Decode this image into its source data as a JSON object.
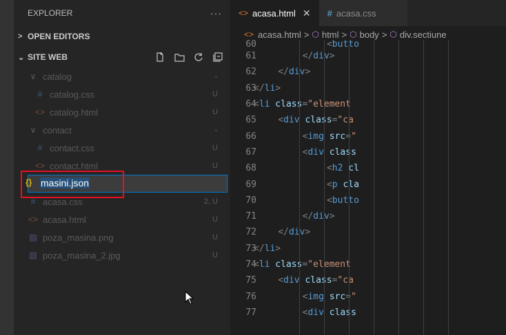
{
  "sidebar": {
    "title": "EXPLORER",
    "more": "···",
    "open_editors": "OPEN EDITORS",
    "workspace": "SITE WEB",
    "tree": [
      {
        "name": "catalog",
        "icon": "chevron-down-icon",
        "badge": "",
        "kind": "folder"
      },
      {
        "name": "catalog.css",
        "icon": "css-file-icon",
        "badge": "U",
        "kind": "css"
      },
      {
        "name": "catalog.html",
        "icon": "html-file-icon",
        "badge": "U",
        "kind": "html"
      },
      {
        "name": "contact",
        "icon": "chevron-down-icon",
        "badge": "",
        "kind": "folder"
      },
      {
        "name": "contact.css",
        "icon": "css-file-icon",
        "badge": "U",
        "kind": "css"
      },
      {
        "name": "contact.html",
        "icon": "html-file-icon",
        "badge": "U",
        "kind": "html"
      }
    ],
    "rename_value": "masini.json",
    "tree_after": [
      {
        "name": "acasa.css",
        "icon": "css-file-icon",
        "badge": "2, U",
        "kind": "css"
      },
      {
        "name": "acasa.html",
        "icon": "html-file-icon",
        "badge": "U",
        "kind": "html"
      },
      {
        "name": "poza_masina.png",
        "icon": "image-file-icon",
        "badge": "U",
        "kind": "img"
      },
      {
        "name": "poza_masina_2.jpg",
        "icon": "image-file-icon",
        "badge": "U",
        "kind": "img"
      }
    ]
  },
  "tabs": [
    {
      "label": "acasa.html",
      "active": true
    },
    {
      "label": "acasa.css",
      "active": false
    }
  ],
  "breadcrumb": [
    "acasa.html",
    "html",
    "body",
    "div.sectiune"
  ],
  "code": {
    "lines": [
      {
        "n": "60",
        "indent": 8,
        "parts": [
          [
            "punct",
            "<"
          ],
          [
            "tag",
            "butto"
          ]
        ]
      },
      {
        "n": "61",
        "indent": 7,
        "parts": [
          [
            "punct",
            "</"
          ],
          [
            "tag",
            "div"
          ],
          [
            "punct",
            ">"
          ]
        ]
      },
      {
        "n": "62",
        "indent": 6,
        "parts": [
          [
            "punct",
            "</"
          ],
          [
            "tag",
            "div"
          ],
          [
            "punct",
            ">"
          ]
        ]
      },
      {
        "n": "63",
        "indent": 5,
        "parts": [
          [
            "punct",
            "</"
          ],
          [
            "tag",
            "li"
          ],
          [
            "punct",
            ">"
          ]
        ]
      },
      {
        "n": "64",
        "indent": 5,
        "parts": [
          [
            "punct",
            "<"
          ],
          [
            "tag",
            "li"
          ],
          [
            "attr",
            " class"
          ],
          [
            "punct",
            "="
          ],
          [
            "str",
            "\"element"
          ]
        ]
      },
      {
        "n": "65",
        "indent": 6,
        "parts": [
          [
            "punct",
            "<"
          ],
          [
            "tag",
            "div"
          ],
          [
            "attr",
            " class"
          ],
          [
            "punct",
            "="
          ],
          [
            "str",
            "\"ca"
          ]
        ]
      },
      {
        "n": "66",
        "indent": 7,
        "parts": [
          [
            "punct",
            "<"
          ],
          [
            "tag",
            "img"
          ],
          [
            "attr",
            " src"
          ],
          [
            "punct",
            "="
          ],
          [
            "str",
            "\""
          ]
        ]
      },
      {
        "n": "67",
        "indent": 7,
        "parts": [
          [
            "punct",
            "<"
          ],
          [
            "tag",
            "div"
          ],
          [
            "attr",
            " class"
          ]
        ]
      },
      {
        "n": "68",
        "indent": 8,
        "parts": [
          [
            "punct",
            "<"
          ],
          [
            "tag",
            "h2"
          ],
          [
            "attr",
            " cl"
          ]
        ]
      },
      {
        "n": "69",
        "indent": 8,
        "parts": [
          [
            "punct",
            "<"
          ],
          [
            "tag",
            "p"
          ],
          [
            "attr",
            " cla"
          ]
        ]
      },
      {
        "n": "70",
        "indent": 8,
        "parts": [
          [
            "punct",
            "<"
          ],
          [
            "tag",
            "butto"
          ]
        ]
      },
      {
        "n": "71",
        "indent": 7,
        "parts": [
          [
            "punct",
            "</"
          ],
          [
            "tag",
            "div"
          ],
          [
            "punct",
            ">"
          ]
        ]
      },
      {
        "n": "72",
        "indent": 6,
        "parts": [
          [
            "punct",
            "</"
          ],
          [
            "tag",
            "div"
          ],
          [
            "punct",
            ">"
          ]
        ]
      },
      {
        "n": "73",
        "indent": 5,
        "parts": [
          [
            "punct",
            "</"
          ],
          [
            "tag",
            "li"
          ],
          [
            "punct",
            ">"
          ]
        ]
      },
      {
        "n": "74",
        "indent": 5,
        "parts": [
          [
            "punct",
            "<"
          ],
          [
            "tag",
            "li"
          ],
          [
            "attr",
            " class"
          ],
          [
            "punct",
            "="
          ],
          [
            "str",
            "\"element"
          ]
        ]
      },
      {
        "n": "75",
        "indent": 6,
        "parts": [
          [
            "punct",
            "<"
          ],
          [
            "tag",
            "div"
          ],
          [
            "attr",
            " class"
          ],
          [
            "punct",
            "="
          ],
          [
            "str",
            "\"ca"
          ]
        ]
      },
      {
        "n": "76",
        "indent": 7,
        "parts": [
          [
            "punct",
            "<"
          ],
          [
            "tag",
            "img"
          ],
          [
            "attr",
            " src"
          ],
          [
            "punct",
            "="
          ],
          [
            "str",
            "\""
          ]
        ]
      },
      {
        "n": "77",
        "indent": 7,
        "parts": [
          [
            "punct",
            "<"
          ],
          [
            "tag",
            "div"
          ],
          [
            "attr",
            " class"
          ]
        ]
      }
    ]
  },
  "colors": {
    "accent": "#007acc",
    "highlight": "#e81123",
    "json_icon": "#e0b000"
  }
}
